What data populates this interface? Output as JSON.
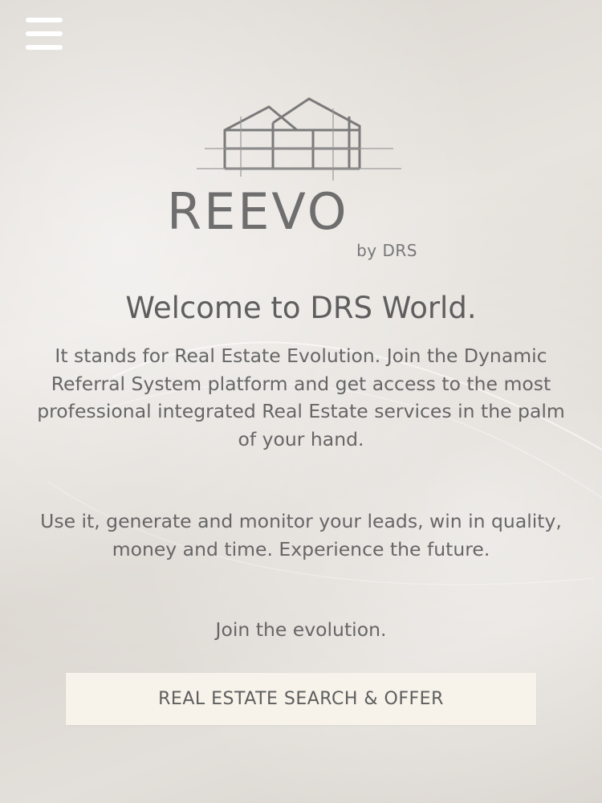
{
  "header": {
    "menu_icon": "hamburger-menu-icon"
  },
  "brand": {
    "name": "REEVO",
    "byline": "by DRS",
    "logo_icon": "house-wireframe-logo-icon"
  },
  "content": {
    "title": "Welcome to DRS World.",
    "paragraph_1": "It stands for Real Estate Evolution. Join the Dynamic Referral System platform and get access to the most professional integrated Real Estate services in the palm of your hand.",
    "paragraph_2": "Use it, generate and monitor your leads, win in quality, money and time. Experience the future.",
    "paragraph_3": "Join the evolution."
  },
  "cta": {
    "label": "REAL ESTATE SEARCH & OFFER"
  },
  "colors": {
    "background": "#e2ddd8",
    "text": "#666666",
    "button_bg": "#f7f2ea",
    "menu_icon": "#ffffff"
  }
}
